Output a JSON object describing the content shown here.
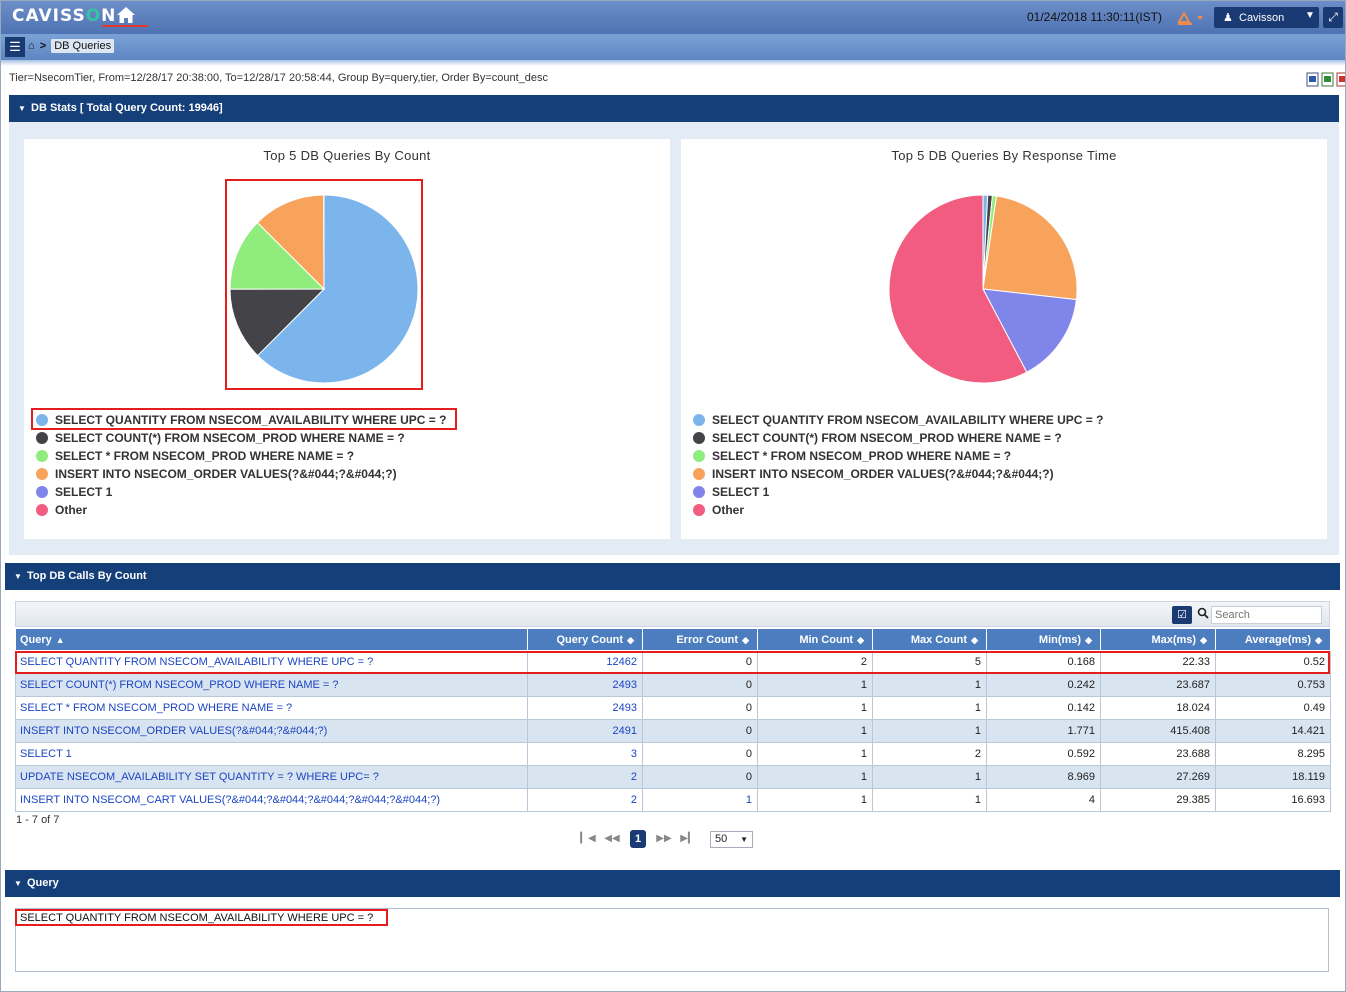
{
  "header": {
    "logo_prefix": "CAVISS",
    "logo_o": "O",
    "logo_suffix": "N",
    "datetime": "01/24/2018 11:30:11(IST)",
    "user_name": "Cavisson"
  },
  "breadcrumb": {
    "separator": ">",
    "current": "DB Queries"
  },
  "filter_text": "Tier=NsecomTier, From=12/28/17 20:38:00, To=12/28/17 20:58:44, Group By=query,tier, Order By=count_desc",
  "db_stats": {
    "title": "DB Stats [ Total Query Count: 19946]"
  },
  "legend_colors": [
    "#7cb5ec",
    "#434348",
    "#90ed7d",
    "#f7a35c",
    "#8085e9",
    "#f15c80"
  ],
  "legend_labels": [
    "SELECT QUANTITY FROM NSECOM_AVAILABILITY WHERE UPC = ?",
    "SELECT COUNT(*) FROM NSECOM_PROD WHERE NAME = ?",
    "SELECT * FROM NSECOM_PROD WHERE NAME = ?",
    "INSERT INTO NSECOM_ORDER VALUES(?&#044;?&#044;?)",
    "SELECT 1",
    "Other"
  ],
  "chart_data": [
    {
      "type": "pie",
      "title": "Top 5 DB Queries By Count",
      "labels": [
        "SELECT QUANTITY FROM NSECOM_AVAILABILITY WHERE UPC = ?",
        "SELECT COUNT(*) FROM NSECOM_PROD WHERE NAME = ?",
        "SELECT * FROM NSECOM_PROD WHERE NAME = ?",
        "INSERT INTO NSECOM_ORDER VALUES(?&#044;?&#044;?)",
        "SELECT 1",
        "Other"
      ],
      "values": [
        12462,
        2493,
        2493,
        2491,
        3,
        4
      ],
      "legend": "bottom-left"
    },
    {
      "type": "pie",
      "title": "Top 5 DB Queries By Response Time",
      "labels": [
        "SELECT QUANTITY FROM NSECOM_AVAILABILITY WHERE UPC = ?",
        "SELECT COUNT(*) FROM NSECOM_PROD WHERE NAME = ?",
        "SELECT * FROM NSECOM_PROD WHERE NAME = ?",
        "INSERT INTO NSECOM_ORDER VALUES(?&#044;?&#044;?)",
        "SELECT 1",
        "Other"
      ],
      "values": [
        0.8,
        0.8,
        0.7,
        24.5,
        15.5,
        57.7
      ],
      "legend": "bottom-left"
    }
  ],
  "top_calls": {
    "title": "Top DB Calls By Count",
    "search_placeholder": "Search",
    "columns": [
      "Query",
      "Query Count",
      "Error Count",
      "Min Count",
      "Max Count",
      "Min(ms)",
      "Max(ms)",
      "Average(ms)"
    ],
    "rows": [
      [
        "SELECT QUANTITY FROM NSECOM_AVAILABILITY WHERE UPC = ?",
        "12462",
        "0",
        "2",
        "5",
        "0.168",
        "22.33",
        "0.52"
      ],
      [
        "SELECT COUNT(*) FROM NSECOM_PROD WHERE NAME = ?",
        "2493",
        "0",
        "1",
        "1",
        "0.242",
        "23.687",
        "0.753"
      ],
      [
        "SELECT * FROM NSECOM_PROD WHERE NAME = ?",
        "2493",
        "0",
        "1",
        "1",
        "0.142",
        "18.024",
        "0.49"
      ],
      [
        "INSERT INTO NSECOM_ORDER VALUES(?&#044;?&#044;?)",
        "2491",
        "0",
        "1",
        "1",
        "1.771",
        "415.408",
        "14.421"
      ],
      [
        "SELECT 1",
        "3",
        "0",
        "1",
        "2",
        "0.592",
        "23.688",
        "8.295"
      ],
      [
        "UPDATE NSECOM_AVAILABILITY SET QUANTITY = ? WHERE UPC= ?",
        "2",
        "0",
        "1",
        "1",
        "8.969",
        "27.269",
        "18.119"
      ],
      [
        "INSERT INTO NSECOM_CART VALUES(?&#044;?&#044;?&#044;?&#044;?&#044;?)",
        "2",
        "1",
        "1",
        "1",
        "4",
        "29.385",
        "16.693"
      ]
    ],
    "pager_info": "1 - 7 of 7",
    "current_page": "1",
    "page_size": "50"
  },
  "query_section": {
    "title": "Query",
    "text": "SELECT QUANTITY FROM NSECOM_AVAILABILITY  WHERE UPC = ?"
  }
}
